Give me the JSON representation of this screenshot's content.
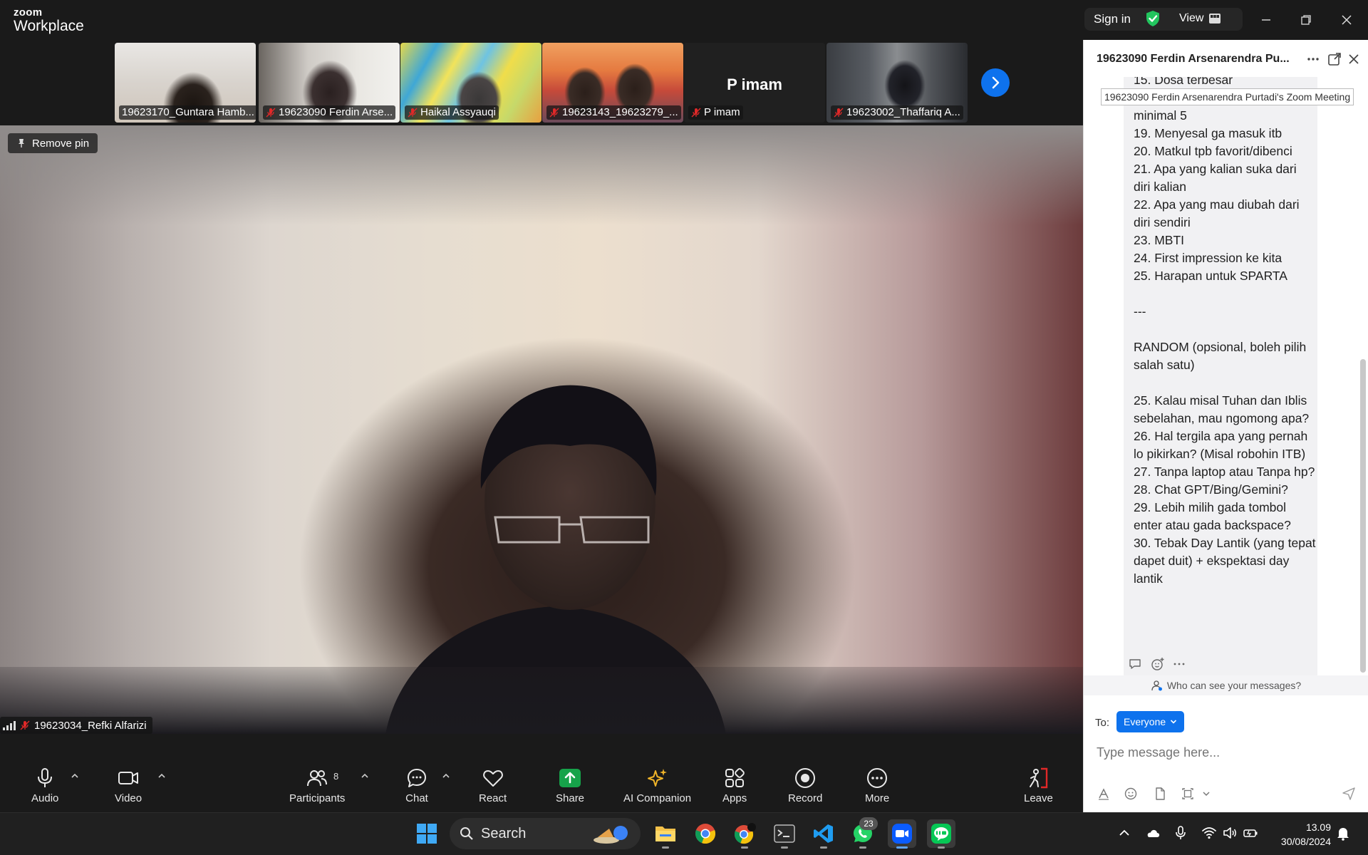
{
  "app": {
    "logo_line1": "zoom",
    "logo_line2": "Workplace",
    "sign_in": "Sign in",
    "view": "View"
  },
  "thumbnails": [
    {
      "name": "19623170_Guntara Hamb...",
      "muted": false
    },
    {
      "name": "19623090 Ferdin Arse...",
      "muted": true
    },
    {
      "name": "Haikal Assyauqi",
      "muted": true
    },
    {
      "name": "19623143_19623279_...",
      "muted": true
    },
    {
      "name": "P imam",
      "muted": true,
      "big_label": "P imam"
    },
    {
      "name": "19623002_Thaffariq A...",
      "muted": true
    }
  ],
  "main_video": {
    "remove_pin": "Remove pin",
    "speaker_name": "19623034_Refki Alfarizi"
  },
  "toolbar": {
    "audio": "Audio",
    "video": "Video",
    "participants": "Participants",
    "participants_count": "8",
    "chat": "Chat",
    "react": "React",
    "share": "Share",
    "ai_companion": "AI Companion",
    "apps": "Apps",
    "record": "Record",
    "more": "More",
    "leave": "Leave"
  },
  "chat": {
    "title": "19623090 Ferdin Arsenarendra Pu...",
    "tooltip": "19623090 Ferdin Arsenarendra Purtadi's Zoom Meeting",
    "message_lines": [
      "15. Dosa terbesar",
      "",
      "minimal 5",
      "19. Menyesal ga masuk itb",
      "20. Matkul tpb favorit/dibenci",
      "21. Apa yang kalian suka dari diri kalian",
      "22. Apa yang mau diubah dari diri sendiri",
      "23. MBTI",
      "24. First impression ke kita",
      "25. Harapan untuk SPARTA",
      "",
      "---",
      "",
      "RANDOM (opsional, boleh pilih salah satu)",
      "",
      "25. Kalau misal Tuhan dan Iblis sebelahan, mau ngomong apa?",
      "26. Hal tergila apa yang pernah lo pikirkan? (Misal robohin ITB)",
      "27. Tanpa laptop atau Tanpa hp?",
      "28. Chat GPT/Bing/Gemini?",
      "29. Lebih milih gada tombol enter atau gada backspace?",
      "30. Tebak Day Lantik (yang tepat dapet duit) + ekspektasi day lantik"
    ],
    "who_can_see": "Who can see your messages?",
    "to_label": "To:",
    "recipient": "Everyone",
    "input_placeholder": "Type message here..."
  },
  "taskbar": {
    "search": "Search",
    "whatsapp_badge": "23",
    "time": "13.09",
    "date": "30/08/2024"
  },
  "colors": {
    "accent": "#0e72ed",
    "share_green": "#16a34a",
    "leave_red": "#e02828",
    "shield_green": "#22c55e"
  }
}
